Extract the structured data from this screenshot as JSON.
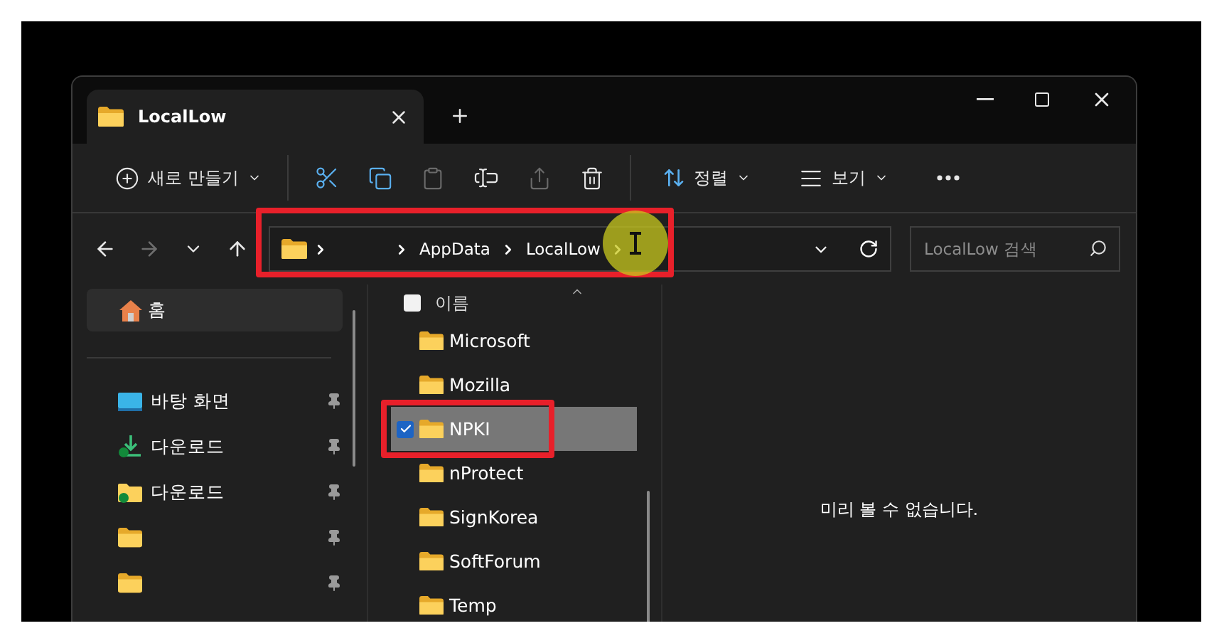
{
  "tabs": [
    {
      "label": "LocalLow",
      "selected": true
    }
  ],
  "toolbar": [
    {
      "kind": "new",
      "label": "새로 만들기"
    },
    {
      "kind": "divider"
    },
    {
      "kind": "cut",
      "disabled": false
    },
    {
      "kind": "copy",
      "disabled": false
    },
    {
      "kind": "paste",
      "disabled": true
    },
    {
      "kind": "rename",
      "disabled": false
    },
    {
      "kind": "share",
      "disabled": true
    },
    {
      "kind": "delete",
      "disabled": false
    },
    {
      "kind": "divider"
    },
    {
      "kind": "sort",
      "label": "정렬"
    },
    {
      "kind": "view",
      "label": "보기"
    },
    {
      "kind": "more"
    }
  ],
  "navigation": [
    {
      "kind": "back",
      "disabled": false
    },
    {
      "kind": "forward",
      "disabled": true
    },
    {
      "kind": "recent",
      "disabled": false
    },
    {
      "kind": "up",
      "disabled": false
    }
  ],
  "address": {
    "segments": [
      {
        "kind": "folder"
      },
      {
        "kind": "blank"
      },
      {
        "kind": "text",
        "label": "AppData"
      },
      {
        "kind": "text",
        "label": "LocalLow"
      }
    ]
  },
  "search": {
    "placeholder": "LocalLow 검색"
  },
  "sidebar": {
    "home": {
      "label": "홈",
      "selected": true
    },
    "pinned": [
      {
        "kind": "desktop",
        "label": "바탕 화면",
        "pinned": true,
        "selected": false
      },
      {
        "kind": "download",
        "label": "다운로드",
        "pinned": true,
        "selected": false
      },
      {
        "kind": "synced",
        "label": "다운로드",
        "pinned": true,
        "selected": false
      },
      {
        "kind": "folder",
        "pinned": true,
        "selected": false
      },
      {
        "kind": "folder",
        "pinned": true,
        "selected": false
      }
    ]
  },
  "files": {
    "header": "이름",
    "select_all_checked": false,
    "rows": [
      {
        "name": "Microsoft",
        "selected": false
      },
      {
        "name": "Mozilla",
        "selected": false
      },
      {
        "name": "NPKI",
        "selected": true
      },
      {
        "name": "nProtect",
        "selected": false
      },
      {
        "name": "SignKorea",
        "selected": false
      },
      {
        "name": "SoftForum",
        "selected": false
      },
      {
        "name": "Temp",
        "selected": false
      }
    ]
  },
  "preview": {
    "message": "미리 볼 수 없습니다."
  }
}
